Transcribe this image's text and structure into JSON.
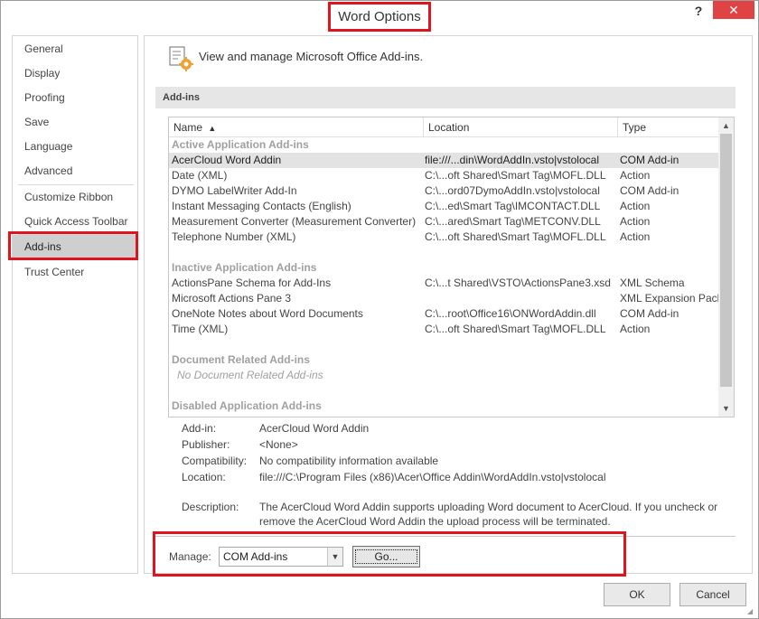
{
  "window": {
    "title": "Word Options",
    "help_label": "?",
    "close_label": "✕"
  },
  "nav": {
    "items": [
      {
        "label": "General"
      },
      {
        "label": "Display"
      },
      {
        "label": "Proofing"
      },
      {
        "label": "Save"
      },
      {
        "label": "Language"
      },
      {
        "label": "Advanced"
      },
      {
        "label": "Customize Ribbon"
      },
      {
        "label": "Quick Access Toolbar"
      },
      {
        "label": "Add-ins",
        "selected": true
      },
      {
        "label": "Trust Center"
      }
    ]
  },
  "main": {
    "header_text": "View and manage Microsoft Office Add-ins.",
    "section_title": "Add-ins",
    "columns": {
      "name": "Name",
      "sort_indicator": "▲",
      "location": "Location",
      "type": "Type"
    },
    "groups": {
      "active": {
        "title": "Active Application Add-ins",
        "rows": [
          {
            "name": "AcerCloud Word Addin",
            "location": "file:///...din\\WordAddIn.vsto|vstolocal",
            "type": "COM Add-in"
          },
          {
            "name": "Date (XML)",
            "location": "C:\\...oft Shared\\Smart Tag\\MOFL.DLL",
            "type": "Action"
          },
          {
            "name": "DYMO LabelWriter Add-In",
            "location": "C:\\...ord07DymoAddIn.vsto|vstolocal",
            "type": "COM Add-in"
          },
          {
            "name": "Instant Messaging Contacts (English)",
            "location": "C:\\...ed\\Smart Tag\\IMCONTACT.DLL",
            "type": "Action"
          },
          {
            "name": "Measurement Converter (Measurement Converter)",
            "location": "C:\\...ared\\Smart Tag\\METCONV.DLL",
            "type": "Action"
          },
          {
            "name": "Telephone Number (XML)",
            "location": "C:\\...oft Shared\\Smart Tag\\MOFL.DLL",
            "type": "Action"
          }
        ]
      },
      "inactive": {
        "title": "Inactive Application Add-ins",
        "rows": [
          {
            "name": "ActionsPane Schema for Add-Ins",
            "location": "C:\\...t Shared\\VSTO\\ActionsPane3.xsd",
            "type": "XML Schema"
          },
          {
            "name": "Microsoft Actions Pane 3",
            "location": "",
            "type": "XML Expansion Pack"
          },
          {
            "name": "OneNote Notes about Word Documents",
            "location": "C:\\...root\\Office16\\ONWordAddin.dll",
            "type": "COM Add-in"
          },
          {
            "name": "Time (XML)",
            "location": "C:\\...oft Shared\\Smart Tag\\MOFL.DLL",
            "type": "Action"
          }
        ]
      },
      "document": {
        "title": "Document Related Add-ins",
        "empty_text": "No Document Related Add-ins"
      },
      "disabled": {
        "title": "Disabled Application Add-ins"
      }
    },
    "details": {
      "addin_label": "Add-in:",
      "addin_value": "AcerCloud Word Addin",
      "publisher_label": "Publisher:",
      "publisher_value": "<None>",
      "compat_label": "Compatibility:",
      "compat_value": "No compatibility information available",
      "location_label": "Location:",
      "location_value": "file:///C:\\Program Files (x86)\\Acer\\Office Addin\\WordAddIn.vsto|vstolocal",
      "description_label": "Description:",
      "description_value": "The AcerCloud Word Addin supports uploading Word document to AcerCloud. If you uncheck or remove the AcerCloud Word Addin the upload process will be terminated."
    },
    "manage": {
      "label": "Manage:",
      "selected": "COM Add-ins",
      "go_label": "Go..."
    }
  },
  "footer": {
    "ok_label": "OK",
    "cancel_label": "Cancel"
  },
  "colors": {
    "highlight_box": "#e0141e",
    "close_button": "#e04343",
    "selected_nav": "#cfcfcf",
    "selected_row": "#e3e3e3"
  }
}
